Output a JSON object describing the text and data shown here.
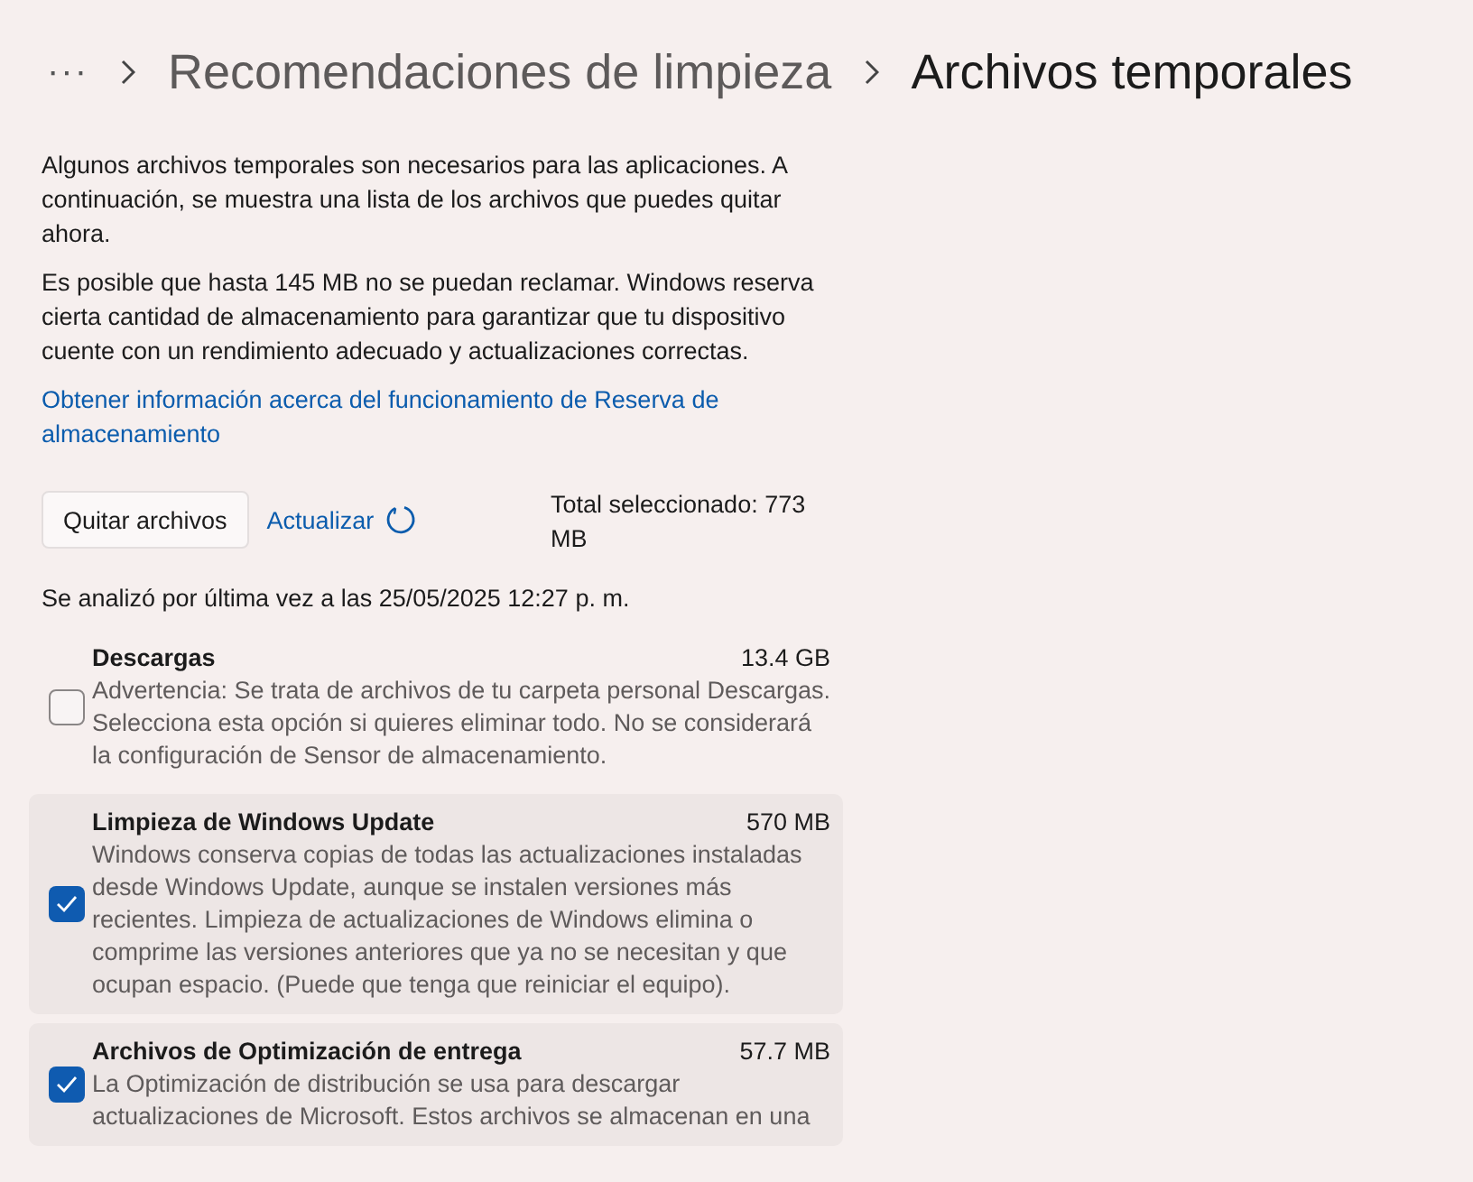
{
  "breadcrumb": {
    "overflow": "···",
    "items": [
      "Recomendaciones de limpieza",
      "Archivos temporales"
    ]
  },
  "intro": [
    "Algunos archivos temporales son necesarios para las aplicaciones. A continuación, se muestra una lista de los archivos que puedes quitar ahora.",
    "Es posible que hasta 145 MB no se puedan reclamar. Windows reserva cierta cantidad de almacenamiento para garantizar que tu dispositivo cuente con un rendimiento adecuado y actualizaciones correctas."
  ],
  "link": "Obtener información acerca del funcionamiento de Reserva de almacenamiento",
  "remove_button": "Quitar archivos",
  "refresh_link": "Actualizar",
  "total": "Total seleccionado: 773 MB",
  "last_scan": "Se analizó por última vez a las 25/05/2025 12:27 p. m.",
  "items": [
    {
      "title": "Descargas",
      "size": "13.4 GB",
      "description": "Advertencia: Se trata de archivos de tu carpeta personal Descargas. Selecciona esta opción si quieres eliminar todo. No se considerará la configuración de Sensor de almacenamiento.",
      "checked": false
    },
    {
      "title": "Limpieza de Windows Update",
      "size": "570 MB",
      "description": "Windows conserva copias de todas las actualizaciones instaladas desde Windows Update, aunque se instalen versiones más recientes. Limpieza de actualizaciones de Windows elimina o comprime las versiones anteriores que ya no se necesitan y que ocupan espacio. (Puede que tenga que reiniciar el equipo).",
      "checked": true
    },
    {
      "title": "Archivos de Optimización de entrega",
      "size": "57.7 MB",
      "description": "La Optimización de distribución se usa para descargar actualizaciones de Microsoft. Estos archivos se almacenan en una",
      "checked": true
    }
  ]
}
